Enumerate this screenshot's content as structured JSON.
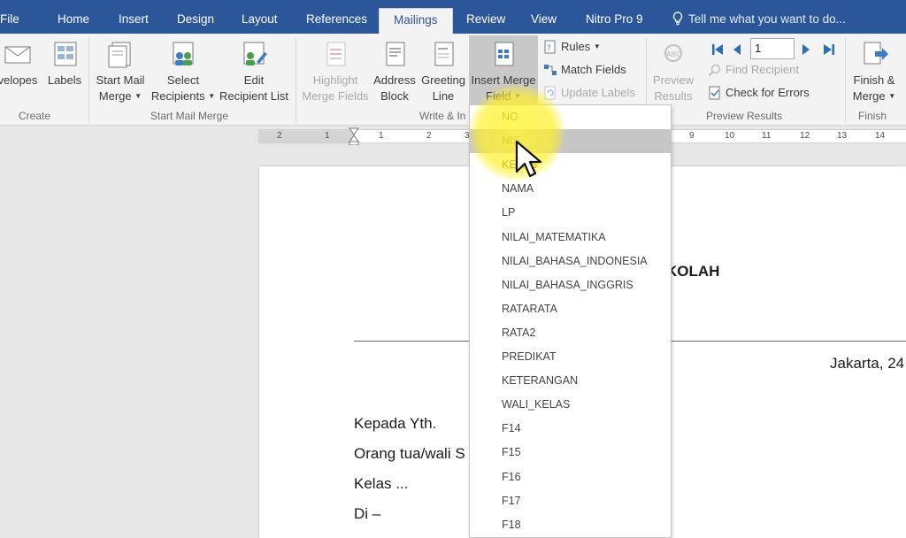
{
  "tabs": [
    "File",
    "Home",
    "Insert",
    "Design",
    "Layout",
    "References",
    "Mailings",
    "Review",
    "View",
    "Nitro Pro 9"
  ],
  "active_tab": "Mailings",
  "tell_me": "Tell me what you want to do...",
  "ribbon": {
    "create": {
      "envelopes": "velopes",
      "labels": "Labels",
      "group": "Create"
    },
    "start": {
      "start_mail_merge": [
        "Start Mail",
        "Merge"
      ],
      "select_recipients": [
        "Select",
        "Recipients"
      ],
      "edit_recipient_list": [
        "Edit",
        "Recipient List"
      ],
      "group": "Start Mail Merge"
    },
    "write": {
      "highlight": [
        "Highlight",
        "Merge Fields"
      ],
      "address_block": [
        "Address",
        "Block"
      ],
      "greeting_line": [
        "Greeting",
        "Line"
      ],
      "insert_merge_field": [
        "Insert Merge",
        "Field"
      ],
      "rules": "Rules",
      "match_fields": "Match Fields",
      "update_labels": "Update Labels",
      "group": "Write & In"
    },
    "preview": {
      "preview_results": [
        "Preview",
        "Results"
      ],
      "record": "1",
      "find_recipient": "Find Recipient",
      "check_errors": "Check for Errors",
      "group": "Preview Results"
    },
    "finish": {
      "finish_merge": [
        "Finish &",
        "Merge"
      ],
      "group": "Finish"
    }
  },
  "ruler_numbers": [
    "2",
    "1",
    "1",
    "2",
    "3",
    "9",
    "10",
    "11",
    "12",
    "13",
    "14"
  ],
  "merge_fields": [
    "NO",
    "NIS",
    "KELAS",
    "NAMA",
    "LP",
    "NILAI_MATEMATIKA",
    "NILAI_BAHASA_INDONESIA",
    "NILAI_BAHASA_INGGRIS",
    "RATARATA",
    "RATA2",
    "PREDIKAT",
    "KETERANGAN",
    "WALI_KELAS",
    "F14",
    "F15",
    "F16",
    "F17",
    "F18"
  ],
  "hovered_field": "NIS",
  "document": {
    "heading_fragment": "KOLAH",
    "date_fragment": "Jakarta, 24",
    "lines": [
      "Kepada Yth.",
      "Orang tua/wali S",
      "Kelas ...",
      "Di –"
    ]
  },
  "colors": {
    "title_bar": "#2b579a",
    "ribbon": "#f3f3f3",
    "workspace": "#e7e7e7"
  }
}
